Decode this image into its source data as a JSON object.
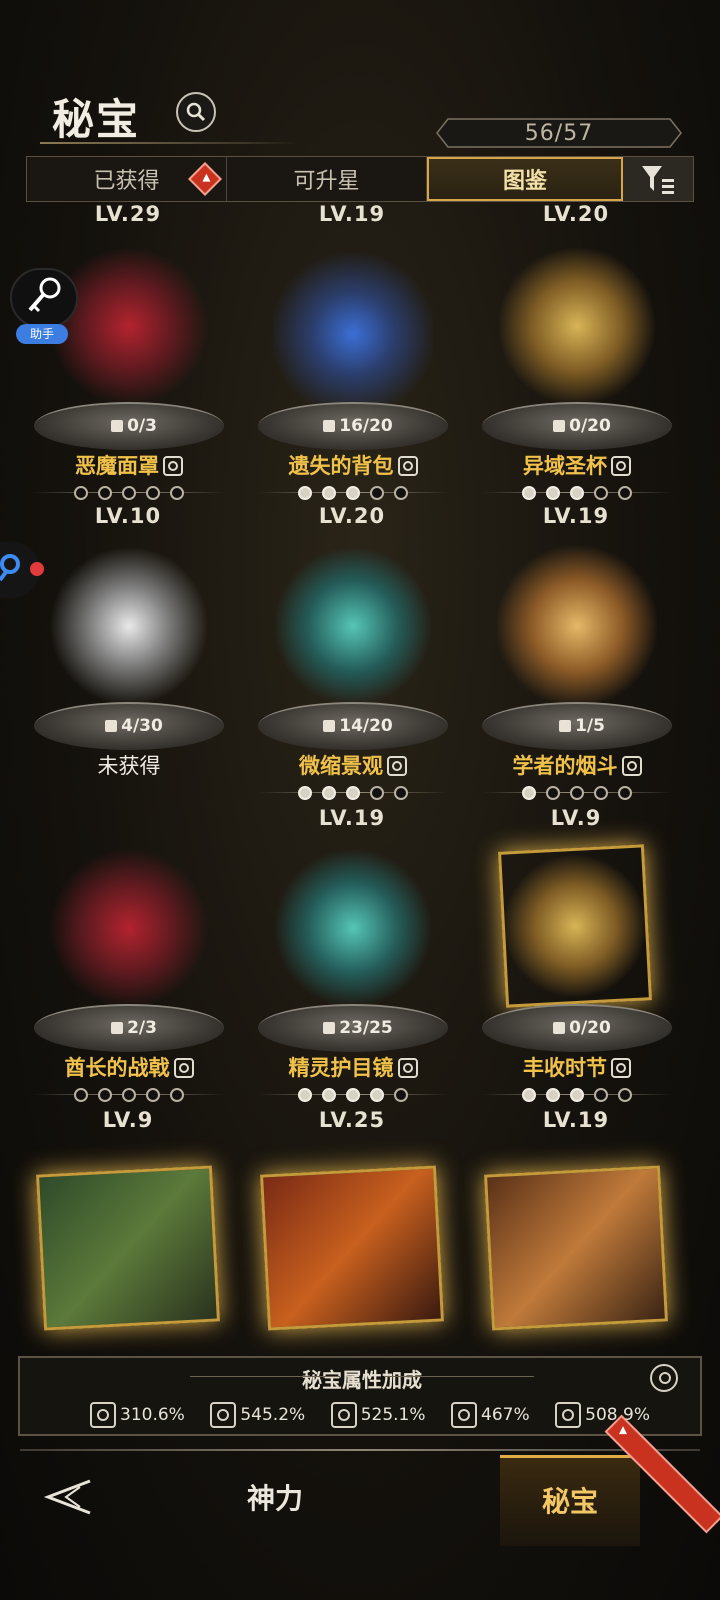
{
  "header": {
    "title": "秘宝",
    "counter": "56/57"
  },
  "tabs": [
    {
      "label": "已获得",
      "badge": true
    },
    {
      "label": "可升星",
      "badge": false
    },
    {
      "label": "图鉴",
      "active": true
    }
  ],
  "side": {
    "helper_label": "助手"
  },
  "top_levels": [
    "LV.29",
    "LV.19",
    "LV.20"
  ],
  "items": [
    {
      "name": "恶魔面罩",
      "shards": "0/3",
      "stars": 5,
      "stars_on": 0,
      "level": "LV.10",
      "owned": true,
      "glow": "red"
    },
    {
      "name": "遗失的背包",
      "shards": "16/20",
      "stars": 5,
      "stars_on": 3,
      "level": "LV.20",
      "owned": true,
      "glow": "blue"
    },
    {
      "name": "异域圣杯",
      "shards": "0/20",
      "stars": 5,
      "stars_on": 3,
      "level": "LV.19",
      "owned": true,
      "glow": "gold"
    },
    {
      "name": "未获得",
      "shards": "4/30",
      "stars": 0,
      "stars_on": 0,
      "level": "",
      "owned": false,
      "glow": "white"
    },
    {
      "name": "微缩景观",
      "shards": "14/20",
      "stars": 5,
      "stars_on": 3,
      "level": "LV.19",
      "owned": true,
      "glow": "teal"
    },
    {
      "name": "学者的烟斗",
      "shards": "1/5",
      "stars": 5,
      "stars_on": 1,
      "level": "LV.9",
      "owned": true,
      "glow": "warm"
    },
    {
      "name": "酋长的战戟",
      "shards": "2/3",
      "stars": 5,
      "stars_on": 0,
      "level": "LV.9",
      "owned": true,
      "glow": "red"
    },
    {
      "name": "精灵护目镜",
      "shards": "23/25",
      "stars": 5,
      "stars_on": 4,
      "level": "LV.25",
      "owned": true,
      "glow": "teal"
    },
    {
      "name": "丰收时节",
      "shards": "0/20",
      "stars": 5,
      "stars_on": 3,
      "level": "LV.19",
      "owned": true,
      "glow": "gold"
    }
  ],
  "attr_panel": {
    "title": "秘宝属性加成",
    "values": [
      "310.6%",
      "545.2%",
      "525.1%",
      "467%",
      "508.9%"
    ]
  },
  "nav": {
    "god": "神力",
    "treasure": "秘宝"
  }
}
